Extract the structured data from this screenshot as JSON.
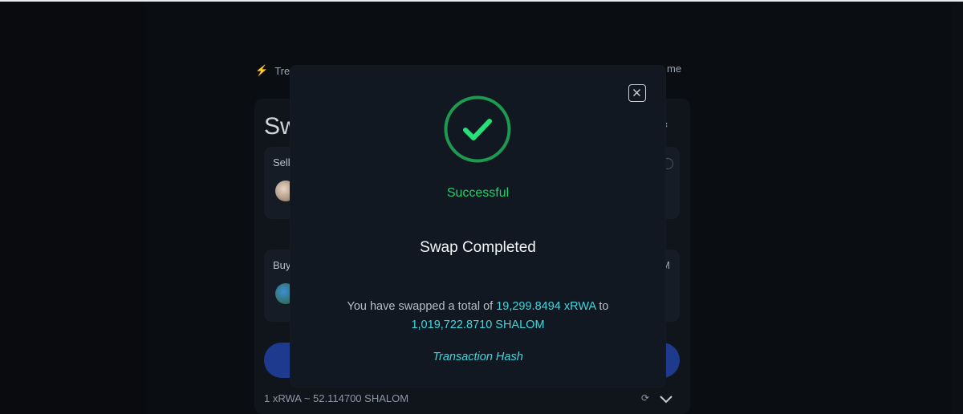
{
  "background": {
    "trending": {
      "label": "Tre",
      "right_text": "me"
    },
    "swap_title": "Sw",
    "sell_label": "Sell",
    "buy_label": "Buy",
    "buy_right_text": "M",
    "rate_text": "1 xRWA ~ 52.114700 SHALOM"
  },
  "modal": {
    "status": "Successful",
    "title": "Swap Completed",
    "summary_prefix": "You have swapped a total of",
    "amount_in": "19,299.8494 xRWA",
    "summary_connector": "to",
    "amount_out": "1,019,722.8710 SHALOM",
    "tx_link": "Transaction Hash"
  },
  "icons": {
    "close": "close-icon",
    "success": "checkmark-circle-icon",
    "settings": "gear-icon",
    "refresh": "refresh-icon",
    "chevron": "chevron-down-icon",
    "bolt": "lightning-icon"
  },
  "colors": {
    "success_green": "#20d06b",
    "accent_cyan": "#42d6dc",
    "button_blue": "#1e3a8f"
  }
}
